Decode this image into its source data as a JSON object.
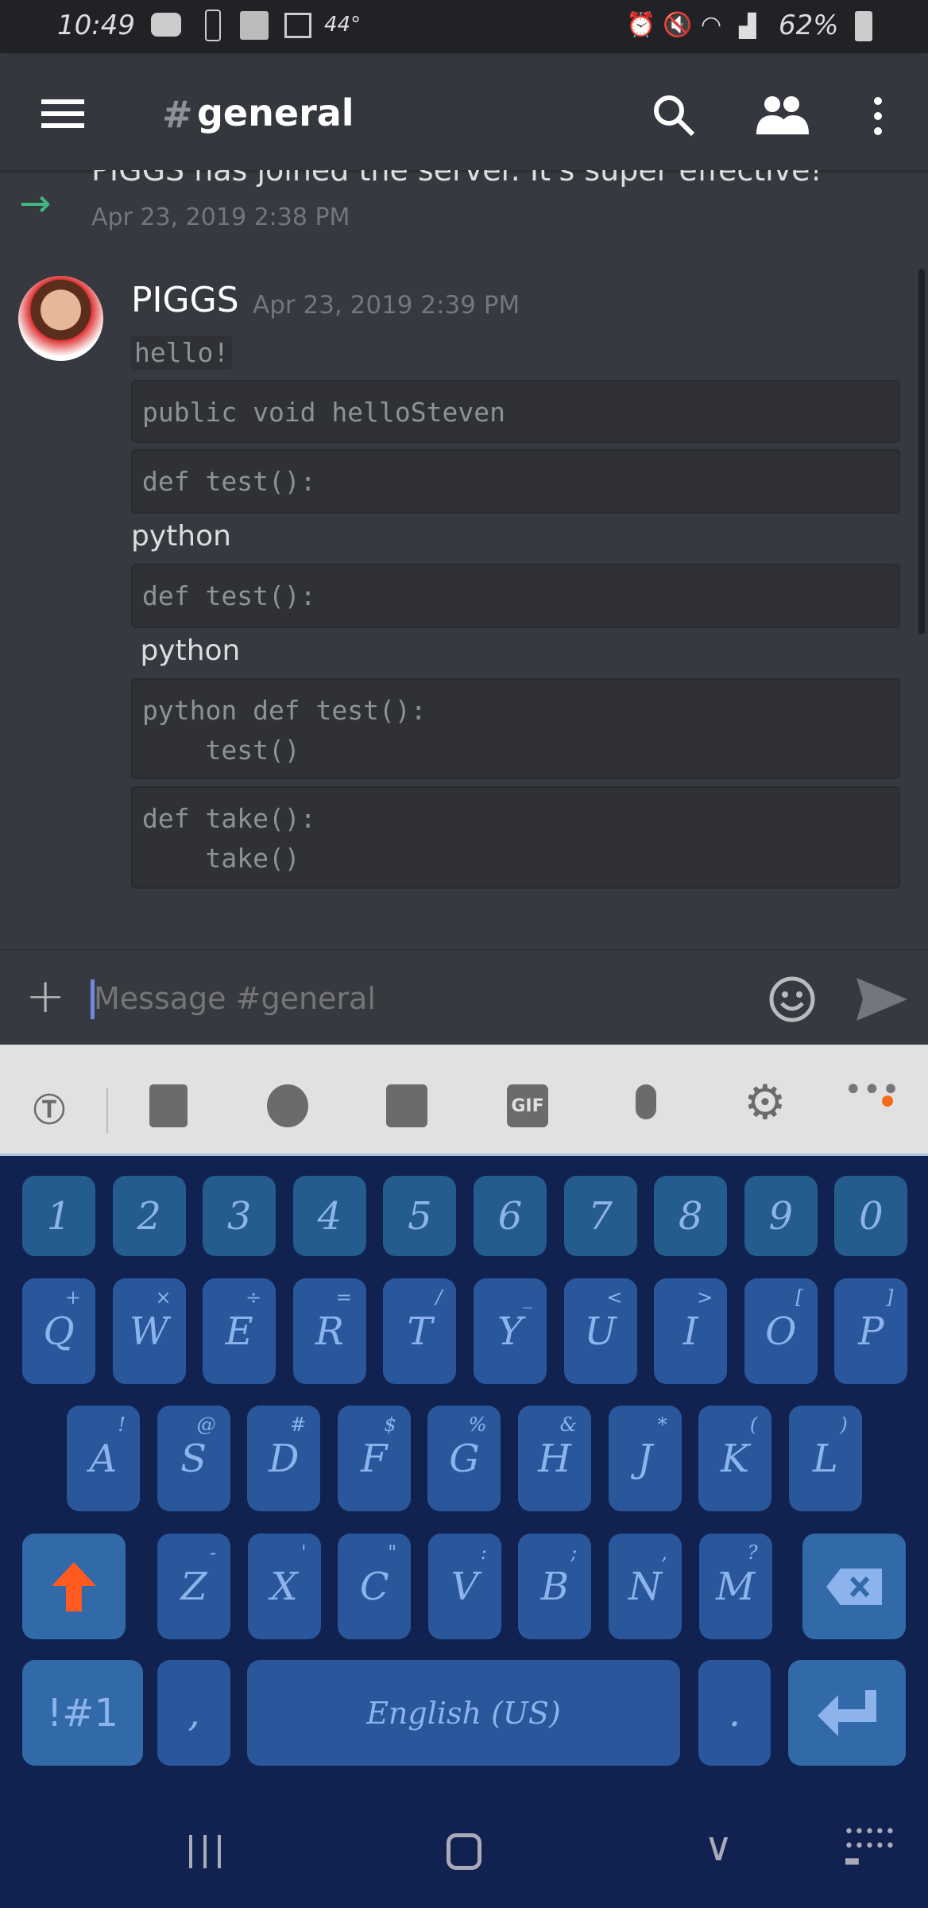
{
  "status_bar": {
    "time": "10:49",
    "temperature": "44°",
    "battery": "62%"
  },
  "header": {
    "hash": "#",
    "channel": "general"
  },
  "join_message": {
    "text": "PIGGS has joined the server. It's super effective!",
    "timestamp": "Apr 23, 2019 2:38 PM"
  },
  "message": {
    "author": "PIGGS",
    "timestamp": "Apr 23, 2019 2:39 PM",
    "inline_code": "hello!",
    "blocks": [
      {
        "type": "code",
        "text": "public void helloSteven"
      },
      {
        "type": "code",
        "text": "def test():"
      },
      {
        "type": "text",
        "text": "python"
      },
      {
        "type": "code",
        "text": "def test():"
      },
      {
        "type": "text",
        "text": " python"
      },
      {
        "type": "code",
        "text": "python def test():\n    test()"
      },
      {
        "type": "code",
        "text": "def take():\n    take()"
      }
    ]
  },
  "composer": {
    "placeholder": "Message #general"
  },
  "keyboard": {
    "toolbar_gif": "GIF",
    "number_row": [
      "1",
      "2",
      "3",
      "4",
      "5",
      "6",
      "7",
      "8",
      "9",
      "0"
    ],
    "row1": [
      [
        "Q",
        "+"
      ],
      [
        "W",
        "×"
      ],
      [
        "E",
        "÷"
      ],
      [
        "R",
        "="
      ],
      [
        "T",
        "/"
      ],
      [
        "Y",
        "_"
      ],
      [
        "U",
        "<"
      ],
      [
        "I",
        ">"
      ],
      [
        "O",
        "["
      ],
      [
        "P",
        "]"
      ]
    ],
    "row2": [
      [
        "A",
        "!"
      ],
      [
        "S",
        "@"
      ],
      [
        "D",
        "#"
      ],
      [
        "F",
        "$"
      ],
      [
        "G",
        "%"
      ],
      [
        "H",
        "&"
      ],
      [
        "J",
        "*"
      ],
      [
        "K",
        "("
      ],
      [
        "L",
        ")"
      ]
    ],
    "row3": [
      [
        "Z",
        "-"
      ],
      [
        "X",
        "'"
      ],
      [
        "C",
        "\""
      ],
      [
        "V",
        ":"
      ],
      [
        "B",
        ";"
      ],
      [
        "N",
        ","
      ],
      [
        "M",
        "?"
      ]
    ],
    "symbols": "!#1",
    "comma": ",",
    "space": "English (US)",
    "period": "."
  },
  "colors": {
    "accent": "#7289da",
    "join_arrow": "#43b581",
    "shift": "#ff5a1f"
  }
}
